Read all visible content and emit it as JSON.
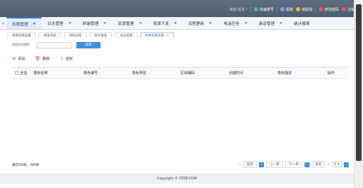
{
  "topbar": {
    "welcome": "欢迎 任文 !",
    "buttons": [
      {
        "label": "快速拨号",
        "color": "#3cc86d"
      },
      {
        "label": "服错",
        "color": "#6aa8f0"
      },
      {
        "label": "待服错",
        "color": "#f2b43c"
      },
      {
        "label": "修改密码",
        "color": "#e05a5a"
      },
      {
        "label": "注销",
        "color": "#e05a5a"
      }
    ]
  },
  "nav": {
    "items": [
      {
        "label": "权限管理",
        "active": true
      },
      {
        "label": "日志管理"
      },
      {
        "label": "终端管理"
      },
      {
        "label": "资源管理"
      },
      {
        "label": "资源下发"
      },
      {
        "label": "远程更新"
      },
      {
        "label": "电话任务"
      },
      {
        "label": "录音管理"
      },
      {
        "label": "统计报表"
      }
    ]
  },
  "tabs": [
    {
      "label": "角色权限设置"
    },
    {
      "label": "端查询录"
    },
    {
      "label": "商陪分组"
    },
    {
      "label": "统计报表"
    },
    {
      "label": "日志管理"
    },
    {
      "label": "角色权限设置",
      "active": true,
      "closable": true
    }
  ],
  "search": {
    "label": "电话机号搜索：",
    "placeholder": "",
    "value": "",
    "button": "搜索"
  },
  "toolbar": {
    "add": "添加",
    "delete": "删除",
    "grant": "授权"
  },
  "table": {
    "columns": [
      "全选",
      "角色名称",
      "角色编号",
      "角色类型",
      "区域编码",
      "创建时间",
      "角色描述",
      "操作"
    ]
  },
  "pager": {
    "info": "每页10条，共0条",
    "first": "首页",
    "prev": "上一页",
    "next": "下一页",
    "last": "末页",
    "page": "1"
  },
  "copyright": "Copyright © FZDP.COM"
}
